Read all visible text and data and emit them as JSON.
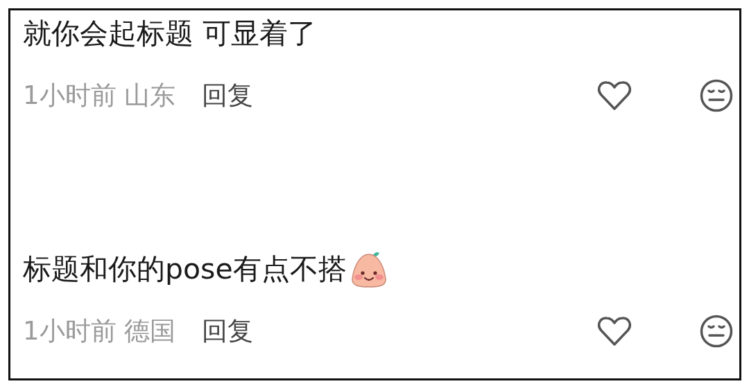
{
  "comments": [
    {
      "text": "就你会起标题 可显着了",
      "sticker": false,
      "time": "1小时前",
      "location": "山东",
      "reply": "回复",
      "liked": false
    },
    {
      "text": "标题和你的pose有点不搭",
      "sticker": true,
      "time": "1小时前",
      "location": "德国",
      "reply": "回复",
      "liked": false
    }
  ]
}
